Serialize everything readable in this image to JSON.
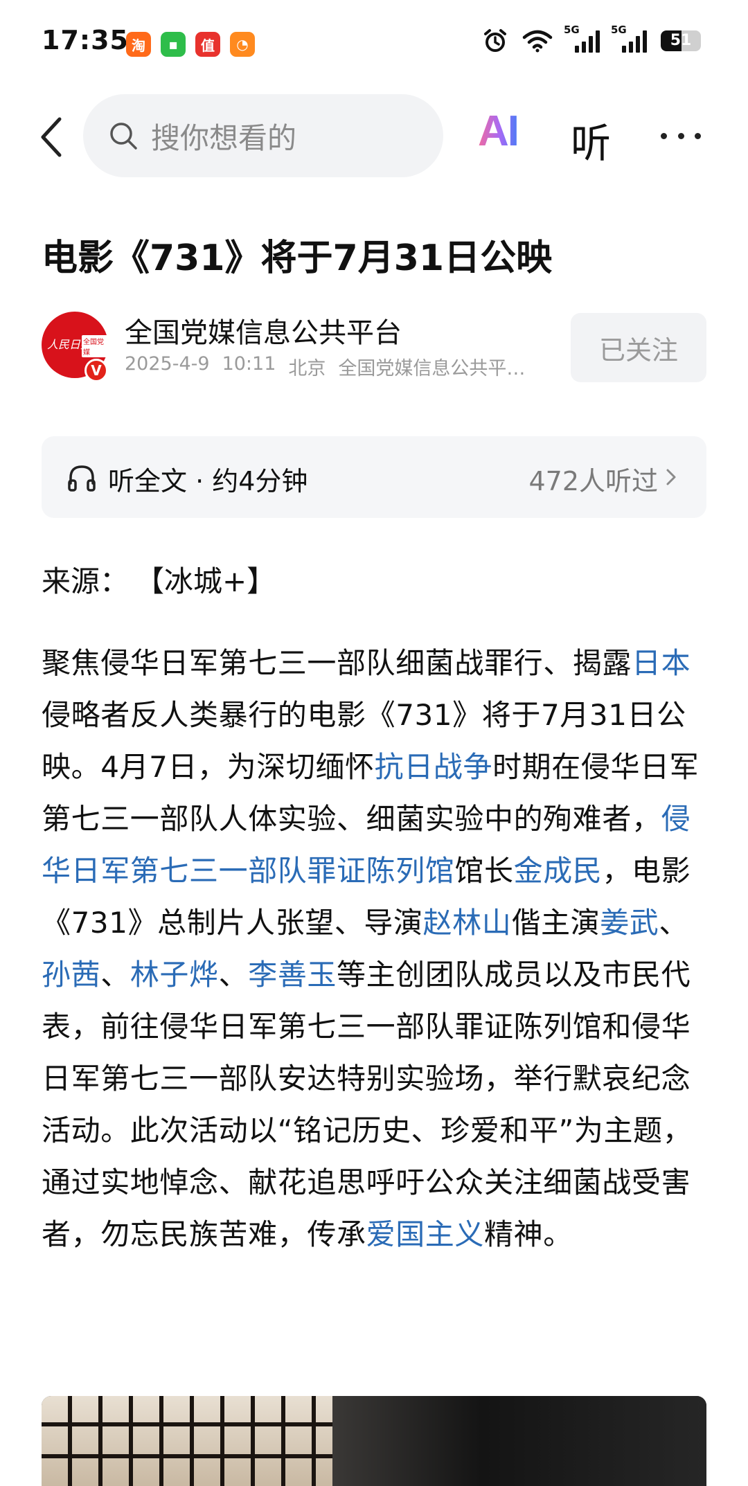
{
  "status_bar": {
    "time": "17:35",
    "apps": [
      {
        "name": "taobao-app-icon",
        "color": "#ff6a1a",
        "glyph": "淘"
      },
      {
        "name": "chat-app-icon",
        "color": "#2ebd4a",
        "glyph": "▪"
      },
      {
        "name": "deals-app-icon",
        "color": "#e8322d",
        "glyph": "值"
      },
      {
        "name": "orange-app-icon",
        "color": "#ff8a1f",
        "glyph": "◔"
      }
    ],
    "network_5g_1": "5G",
    "network_5g_2": "5G",
    "battery_level": "51"
  },
  "nav": {
    "search_placeholder": "搜你想看的",
    "ai_label": "AI",
    "listen_label": "听"
  },
  "article": {
    "title": "电影《731》将于7月31日公映",
    "author": {
      "name": "全国党媒信息公共平台",
      "date": "2025-4-9",
      "time": "10:11",
      "location": "北京",
      "source_short": "全国党媒信息公共平…",
      "avatar_text": "人民日报",
      "avatar_tag": "全国党媒",
      "verified_mark": "V"
    },
    "follow_label": "已关注",
    "listen_bar": {
      "label": "听全文 · 约4分钟",
      "count": "472人听过"
    },
    "source_label": "来源：",
    "source_value": "【冰城+】",
    "body": [
      {
        "t": "聚焦侵华日军第七三一部队细菌战罪行、揭露"
      },
      {
        "t": "日本",
        "link": true
      },
      {
        "t": "侵略者反人类暴行的电影《731》将于7月31日公映。4月7日，为深切缅怀"
      },
      {
        "t": "抗日战争",
        "link": true
      },
      {
        "t": "时期在侵华日军第七三一部队人体实验、细菌实验中的殉难者，"
      },
      {
        "t": "侵华日军第七三一部队罪证陈列馆",
        "link": true
      },
      {
        "t": "馆长"
      },
      {
        "t": "金成民",
        "link": true
      },
      {
        "t": "，电影《731》总制片人张望、导演"
      },
      {
        "t": "赵林山",
        "link": true
      },
      {
        "t": "偕主演"
      },
      {
        "t": "姜武",
        "link": true
      },
      {
        "t": "、"
      },
      {
        "t": "孙茜",
        "link": true
      },
      {
        "t": "、"
      },
      {
        "t": "林子烨",
        "link": true
      },
      {
        "t": "、"
      },
      {
        "t": "李善玉",
        "link": true
      },
      {
        "t": "等主创团队成员以及市民代表，前往侵华日军第七三一部队罪证陈列馆和侵华日军第七三一部队安达特别实验场，举行默哀纪念活动。此次活动以“铭记历史、珍爱和平”为主题，通过实地悼念、献花追思呼吁公众关注细菌战受害者，勿忘民族苦难，传承"
      },
      {
        "t": "爱国主义",
        "link": true
      },
      {
        "t": "精神。"
      }
    ]
  },
  "colors": {
    "link": "#2a6bb6",
    "avatar_red": "#d8121b"
  }
}
